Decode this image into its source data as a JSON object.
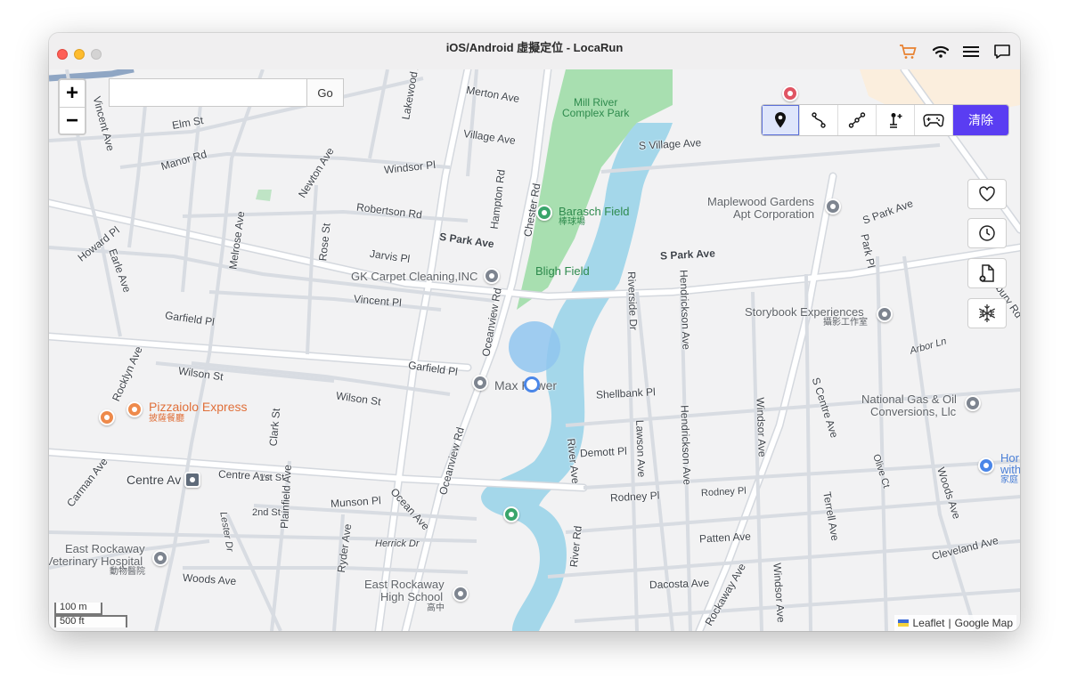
{
  "window": {
    "title": "iOS/Android 虛擬定位 - LocaRun"
  },
  "titlebar_icons": [
    "cart-icon",
    "wifi-icon",
    "menu-icon",
    "chat-icon"
  ],
  "search": {
    "placeholder": "",
    "value": "",
    "go_label": "Go"
  },
  "zoom": {
    "in_label": "+",
    "out_label": "−"
  },
  "modes": {
    "items": [
      "teleport-mode",
      "two-spot-route-mode",
      "multi-spot-route-mode",
      "joystick-mode",
      "gamepad-mode"
    ],
    "active": "teleport-mode",
    "clear_label": "清除"
  },
  "side_buttons": [
    "favorite-icon",
    "history-icon",
    "import-gpx-icon",
    "freeze-icon"
  ],
  "map": {
    "parks": {
      "mill_river": "Mill River\nComplex Park",
      "barasch": "Barasch Field",
      "barasch_sub": "棒球場",
      "bligh": "Bligh Field"
    },
    "roads": [
      {
        "id": "merton-ave",
        "text": "Merton Ave"
      },
      {
        "id": "village-ave",
        "text": "Village Ave"
      },
      {
        "id": "s-village-ave",
        "text": "S Village Ave"
      },
      {
        "id": "elm-st",
        "text": "Elm St"
      },
      {
        "id": "manor-rd",
        "text": "Manor Rd"
      },
      {
        "id": "windsor-pl",
        "text": "Windsor Pl"
      },
      {
        "id": "newton-ave",
        "text": "Newton Ave"
      },
      {
        "id": "robertson-rd",
        "text": "Robertson Rd"
      },
      {
        "id": "hampton-rd",
        "text": "Hampton Rd"
      },
      {
        "id": "chester-rd",
        "text": "Chester Rd"
      },
      {
        "id": "s-park-ave-1",
        "text": "S Park Ave"
      },
      {
        "id": "s-park-ave-2",
        "text": "S Park Ave"
      },
      {
        "id": "s-park-ave-3",
        "text": "S Park Ave"
      },
      {
        "id": "park-pl",
        "text": "Park Pl"
      },
      {
        "id": "jarvis-pl",
        "text": "Jarvis Pl"
      },
      {
        "id": "rose-st",
        "text": "Rose St"
      },
      {
        "id": "melrose-ave",
        "text": "Melrose Ave"
      },
      {
        "id": "howard-pl",
        "text": "Howard Pl"
      },
      {
        "id": "earle-ave",
        "text": "Earle Ave"
      },
      {
        "id": "vincent-pl",
        "text": "Vincent Pl"
      },
      {
        "id": "vincent-ave",
        "text": "Vincent Ave"
      },
      {
        "id": "garfield-pl-1",
        "text": "Garfield Pl"
      },
      {
        "id": "garfield-pl-2",
        "text": "Garfield Pl"
      },
      {
        "id": "oceanview-rd-1",
        "text": "Oceanview Rd"
      },
      {
        "id": "oceanview-rd-2",
        "text": "Oceanview Rd"
      },
      {
        "id": "riverside-dr",
        "text": "Riverside Dr"
      },
      {
        "id": "hendrickson-ave-1",
        "text": "Hendrickson Ave"
      },
      {
        "id": "hendrickson-ave-2",
        "text": "Hendrickson Ave"
      },
      {
        "id": "wilson-st-1",
        "text": "Wilson St"
      },
      {
        "id": "wilson-st-2",
        "text": "Wilson St"
      },
      {
        "id": "rocklyn-ave",
        "text": "Rocklyn Ave"
      },
      {
        "id": "shellbank-pl",
        "text": "Shellbank Pl"
      },
      {
        "id": "s-centre-ave",
        "text": "S Centre Ave"
      },
      {
        "id": "windsor-ave-1",
        "text": "Windsor Ave"
      },
      {
        "id": "windsor-ave-2",
        "text": "Windsor Ave"
      },
      {
        "id": "arbor-ln",
        "text": "Arbor Ln"
      },
      {
        "id": "roxbury-rd",
        "text": "Roxbury Rd"
      },
      {
        "id": "centre-ave",
        "text": "Centre Ave"
      },
      {
        "id": "clark-st",
        "text": "Clark St"
      },
      {
        "id": "river-ave",
        "text": "River Ave"
      },
      {
        "id": "lawson-ave",
        "text": "Lawson Ave"
      },
      {
        "id": "demott-pl",
        "text": "Demott Pl"
      },
      {
        "id": "olive-ct",
        "text": "Olive Ct"
      },
      {
        "id": "woods-ave-1",
        "text": "Woods Ave"
      },
      {
        "id": "woods-ave-2",
        "text": "Woods Ave"
      },
      {
        "id": "terrell-ave",
        "text": "Terrell Ave"
      },
      {
        "id": "carman-ave",
        "text": "Carman Ave"
      },
      {
        "id": "1st-st",
        "text": "1st St"
      },
      {
        "id": "2nd-st",
        "text": "2nd St"
      },
      {
        "id": "plainfield-ave",
        "text": "Plainfield Ave"
      },
      {
        "id": "munson-pl",
        "text": "Munson Pl"
      },
      {
        "id": "ocean-ave",
        "text": "Ocean Ave"
      },
      {
        "id": "rodney-pl-1",
        "text": "Rodney Pl"
      },
      {
        "id": "rodney-pl-2",
        "text": "Rodney Pl"
      },
      {
        "id": "lester-dr",
        "text": "Lester Dr"
      },
      {
        "id": "ryder-ave",
        "text": "Ryder Ave"
      },
      {
        "id": "herrick-dr",
        "text": "Herrick Dr"
      },
      {
        "id": "river-rd",
        "text": "River Rd"
      },
      {
        "id": "patten-ave",
        "text": "Patten Ave"
      },
      {
        "id": "cleveland-ave",
        "text": "Cleveland Ave"
      },
      {
        "id": "dacosta-ave",
        "text": "Dacosta Ave"
      },
      {
        "id": "rockaway-ave",
        "text": "Rockaway Ave"
      },
      {
        "id": "lakewood-ave",
        "text": "Lakewood Ave"
      }
    ],
    "pois": {
      "gk_carpet": "GK Carpet Cleaning,INC",
      "maplewood_1": "Maplewood Gardens",
      "maplewood_2": "Apt Corporation",
      "storybook": "Storybook Experiences",
      "storybook_sub": "攝影工作室",
      "max_power": "Max Power",
      "national_gas_1": "National Gas & Oil",
      "national_gas_2": "Conversions, Llc",
      "pizzaiolo": "Pizzaiolo Express",
      "pizzaiolo_sub": "披薩餐廳",
      "centre_av_station": "Centre Av",
      "vet_1": "East Rockaway",
      "vet_2": "Veterinary Hospital",
      "vet_sub": "動物醫院",
      "school_1": "East Rockaway",
      "school_2": "High School",
      "school_sub": "高中",
      "hor_1": "Hor",
      "hor_2": "with",
      "hor_sub": "家庭"
    }
  },
  "scale": {
    "metric": "100 m",
    "imperial": "500 ft"
  },
  "attribution": {
    "leaflet": "Leaflet",
    "separator": "|",
    "provider": "Google Map"
  },
  "colors": {
    "park": "#a8dfb0",
    "water": "#a4d7ea",
    "road": "#ffffff",
    "road_casing": "#d4d8de",
    "highway": "#8fa6c4",
    "clear_button": "#5a3df2",
    "orange_poi": "#e0703a"
  }
}
